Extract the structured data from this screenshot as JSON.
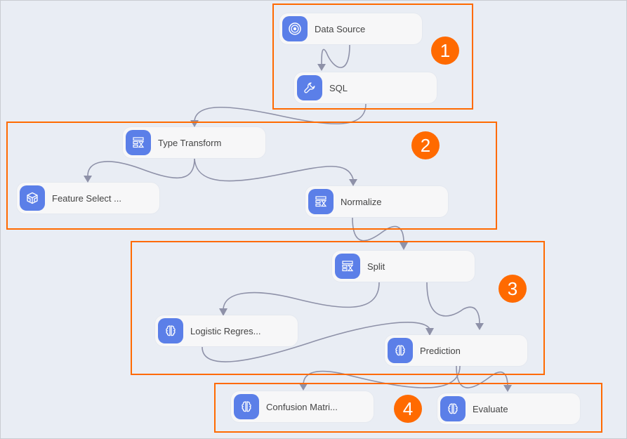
{
  "nodes": [
    {
      "id": "data-source",
      "label": "Data Source",
      "icon": "data-source-icon"
    },
    {
      "id": "sql",
      "label": "SQL",
      "icon": "wrench-icon"
    },
    {
      "id": "type-transform",
      "label": "Type Transform",
      "icon": "table-transform-icon"
    },
    {
      "id": "feature-select",
      "label": "Feature Select ...",
      "icon": "cube-icon"
    },
    {
      "id": "normalize",
      "label": "Normalize",
      "icon": "table-transform-icon"
    },
    {
      "id": "split",
      "label": "Split",
      "icon": "table-transform-icon"
    },
    {
      "id": "logistic-regression",
      "label": "Logistic Regres...",
      "icon": "brain-icon"
    },
    {
      "id": "prediction",
      "label": "Prediction",
      "icon": "brain-icon"
    },
    {
      "id": "confusion-matrix",
      "label": "Confusion Matri...",
      "icon": "brain-icon"
    },
    {
      "id": "evaluate",
      "label": "Evaluate",
      "icon": "brain-icon"
    }
  ],
  "groups": [
    {
      "label": "1"
    },
    {
      "label": "2"
    },
    {
      "label": "3"
    },
    {
      "label": "4"
    }
  ],
  "edges": [
    [
      "data-source",
      "sql"
    ],
    [
      "sql",
      "type-transform"
    ],
    [
      "type-transform",
      "feature-select"
    ],
    [
      "type-transform",
      "normalize"
    ],
    [
      "normalize",
      "split"
    ],
    [
      "split",
      "logistic-regression"
    ],
    [
      "split",
      "prediction"
    ],
    [
      "logistic-regression",
      "prediction"
    ],
    [
      "prediction",
      "confusion-matrix"
    ],
    [
      "prediction",
      "evaluate"
    ]
  ],
  "colors": {
    "accent": "#ff6a00",
    "icon_bg": "#5b7fe8",
    "edge": "#8e91a8",
    "canvas": "#e9edf4"
  }
}
